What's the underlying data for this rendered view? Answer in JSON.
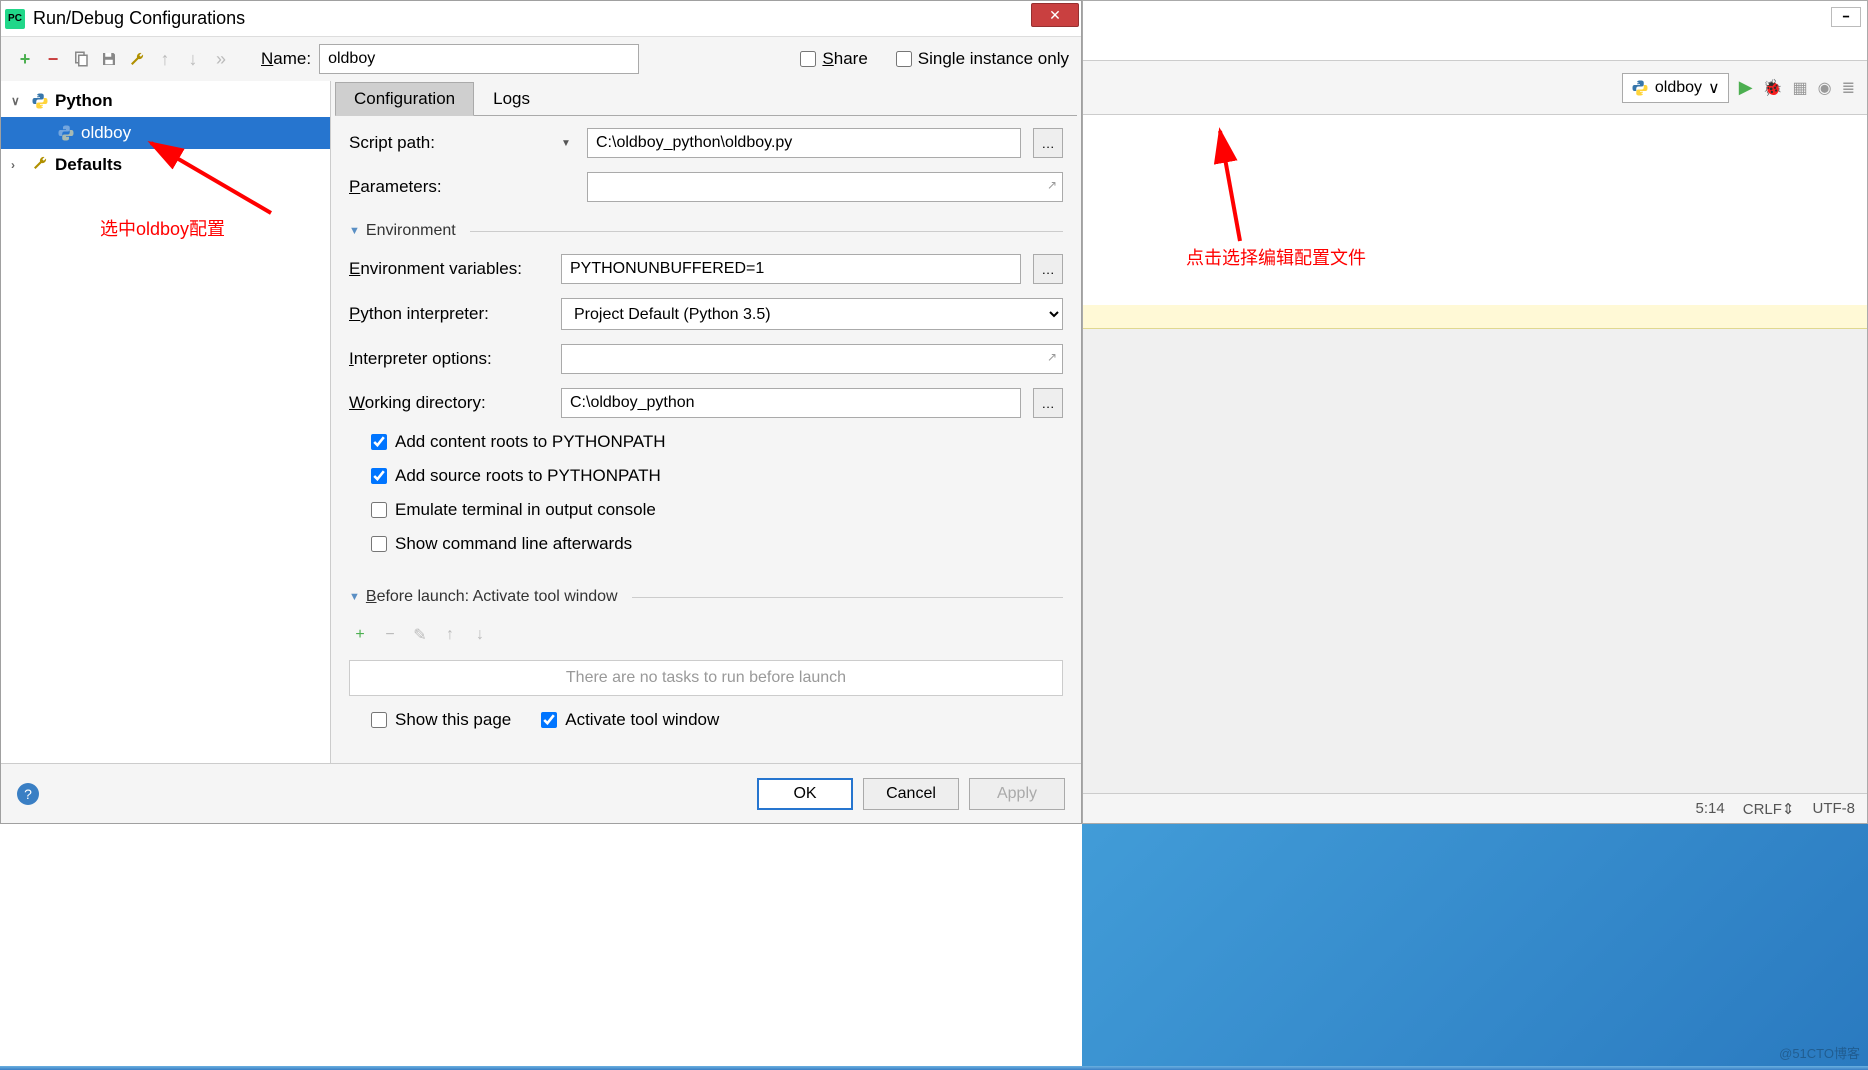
{
  "dialog": {
    "title": "Run/Debug Configurations",
    "name_label": "Name:",
    "name_value": "oldboy",
    "share_label": "Share",
    "single_instance_label": "Single instance only",
    "tree": {
      "python": "Python",
      "oldboy": "oldboy",
      "defaults": "Defaults"
    },
    "tabs": {
      "configuration": "Configuration",
      "logs": "Logs"
    },
    "fields": {
      "script_path_label": "Script path:",
      "script_path_value": "C:\\oldboy_python\\oldboy.py",
      "parameters_label": "Parameters:",
      "parameters_value": "",
      "environment_section": "Environment",
      "env_vars_label": "Environment variables:",
      "env_vars_value": "PYTHONUNBUFFERED=1",
      "interpreter_label": "Python interpreter:",
      "interpreter_value": "Project Default (Python 3.5)",
      "interpreter_options_label": "Interpreter options:",
      "interpreter_options_value": "",
      "working_dir_label": "Working directory:",
      "working_dir_value": "C:\\oldboy_python",
      "add_content_roots": "Add content roots to PYTHONPATH",
      "add_source_roots": "Add source roots to PYTHONPATH",
      "emulate_terminal": "Emulate terminal in output console",
      "show_cmd_after": "Show command line afterwards",
      "before_launch_section": "Before launch: Activate tool window",
      "no_tasks": "There are no tasks to run before launch",
      "show_this_page": "Show this page",
      "activate_tool_window": "Activate tool window"
    },
    "buttons": {
      "ok": "OK",
      "cancel": "Cancel",
      "apply": "Apply"
    }
  },
  "annotations": {
    "left": "选中oldboy配置",
    "right": "点击选择编辑配置文件"
  },
  "pycharm": {
    "config_name": "oldboy",
    "status": {
      "pos": "5:14",
      "line_sep": "CRLF",
      "encoding": "UTF-8"
    }
  },
  "watermark": "@51CTO博客"
}
